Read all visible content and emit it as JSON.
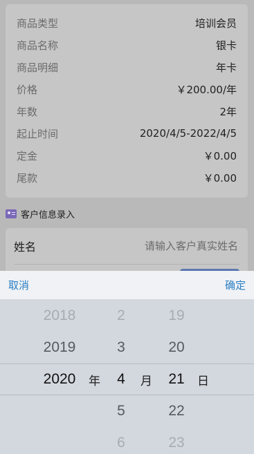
{
  "order": {
    "rows": [
      {
        "label": "商品类型",
        "value": "培训会员"
      },
      {
        "label": "商品名称",
        "value": "银卡"
      },
      {
        "label": "商品明细",
        "value": "年卡"
      },
      {
        "label": "价格",
        "value": "￥200.00/年"
      },
      {
        "label": "年数",
        "value": "2年"
      },
      {
        "label": "起止时间",
        "value": "2020/4/5-2022/4/5"
      },
      {
        "label": "定金",
        "value": "￥0.00"
      },
      {
        "label": "尾款",
        "value": "￥0.00"
      }
    ]
  },
  "customer_section": {
    "icon": "id-card-icon",
    "title": "客户信息录入",
    "name_field": {
      "label": "姓名",
      "placeholder": "请输入客户真实姓名",
      "value": ""
    }
  },
  "picker": {
    "cancel_label": "取消",
    "confirm_label": "确定",
    "years": [
      "2018",
      "2019",
      "2020",
      "",
      ""
    ],
    "months": [
      "2",
      "3",
      "4",
      "5",
      "6"
    ],
    "days": [
      "19",
      "20",
      "21",
      "22",
      "23"
    ],
    "year_unit": "年",
    "month_unit": "月",
    "day_unit": "日",
    "selected": {
      "year": "2020",
      "month": "4",
      "day": "21"
    }
  }
}
